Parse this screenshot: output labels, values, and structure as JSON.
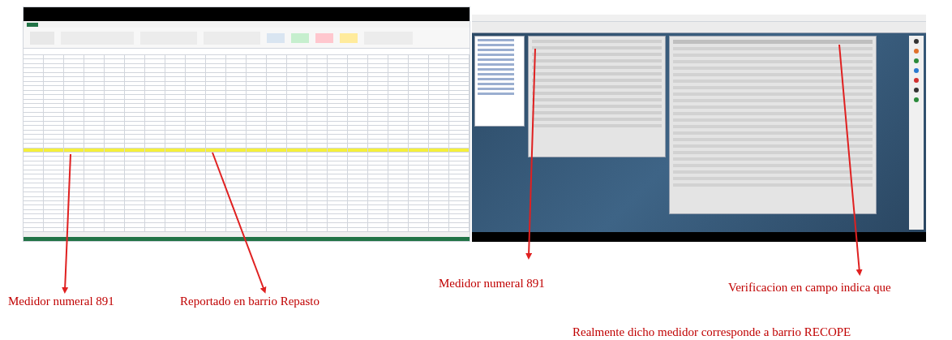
{
  "screenshots": [
    {
      "kind": "spreadsheet"
    },
    {
      "kind": "desktop_app"
    }
  ],
  "callouts": [
    {
      "text": "Medidor numeral 891"
    },
    {
      "text": "Reportado en barrio Repasto"
    },
    {
      "text": "Medidor numeral 891"
    },
    {
      "text": "Verificacion en campo indica que"
    },
    {
      "text": "Realmente dicho medidor corresponde a barrio RECOPE"
    }
  ]
}
